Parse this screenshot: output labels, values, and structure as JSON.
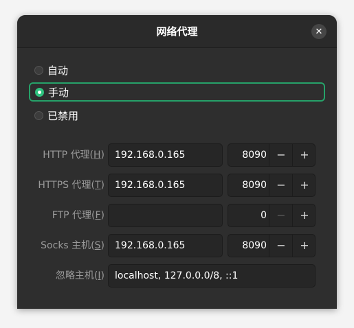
{
  "window": {
    "title": "网络代理",
    "close_glyph": "✕"
  },
  "modes": [
    {
      "label": "自动",
      "selected": false
    },
    {
      "label": "手动",
      "selected": true
    },
    {
      "label": "已禁用",
      "selected": false
    }
  ],
  "proxies": {
    "http": {
      "label": "HTTP 代理(",
      "mnemonic": "H",
      "label_end": ")",
      "host": "192.168.0.165",
      "port": "8090"
    },
    "https": {
      "label": "HTTPS 代理(",
      "mnemonic": "T",
      "label_end": ")",
      "host": "192.168.0.165",
      "port": "8090"
    },
    "ftp": {
      "label": "FTP 代理(",
      "mnemonic": "F",
      "label_end": ")",
      "host": "",
      "port": "0",
      "minus_disabled": true
    },
    "socks": {
      "label": "Socks 主机(",
      "mnemonic": "S",
      "label_end": ")",
      "host": "192.168.0.165",
      "port": "8090"
    }
  },
  "ignore_hosts": {
    "label": "忽略主机(",
    "mnemonic": "I",
    "label_end": ")",
    "value": "localhost, 127.0.0.0/8, ::1"
  },
  "spin_glyphs": {
    "minus": "−",
    "plus": "+"
  },
  "colors": {
    "accent": "#2ec27e",
    "focus_border": "#26a269",
    "background": "#2e2e2e"
  }
}
